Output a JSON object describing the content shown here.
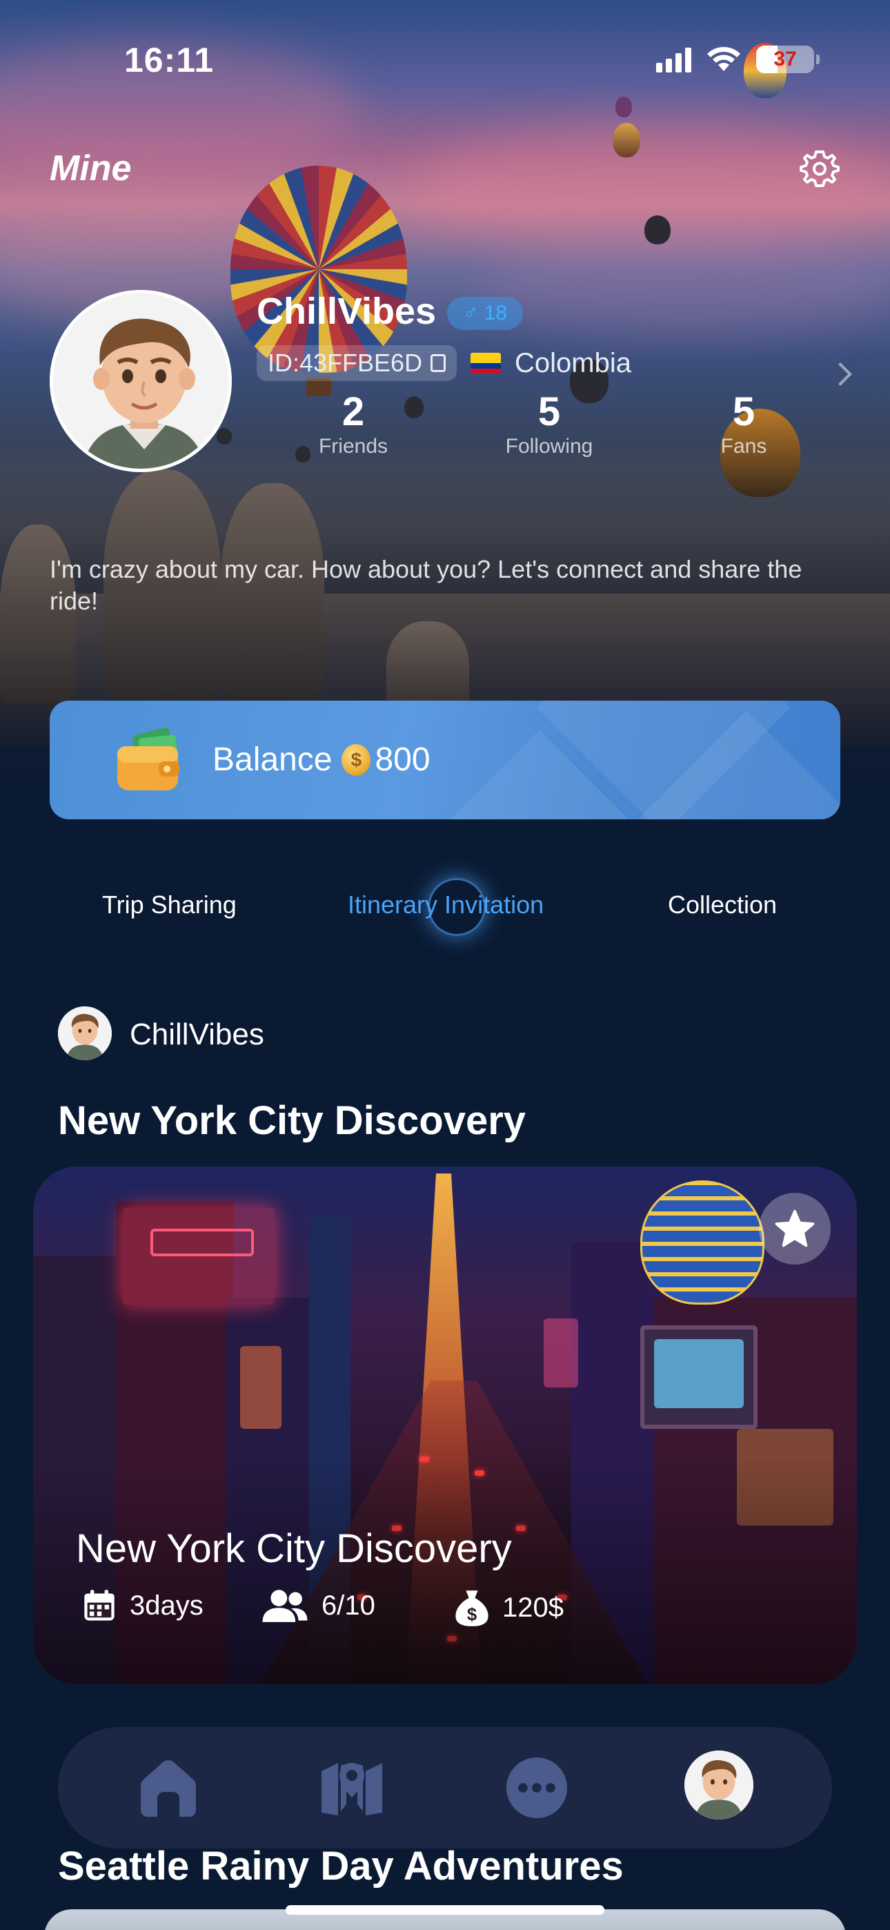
{
  "status_bar": {
    "time": "16:11",
    "battery": "37"
  },
  "header": {
    "title": "Mine"
  },
  "profile": {
    "username": "ChillVibes",
    "level": "18",
    "id": "ID:43FFBE6D",
    "country": "Colombia",
    "stats": [
      {
        "value": "2",
        "label": "Friends"
      },
      {
        "value": "5",
        "label": "Following"
      },
      {
        "value": "5",
        "label": "Fans"
      }
    ],
    "bio": "I'm crazy about my car. How about you? Let's connect and share the ride!"
  },
  "balance": {
    "label": "Balance",
    "amount": "800"
  },
  "tabs": [
    {
      "label": "Trip Sharing",
      "active": false
    },
    {
      "label": "Itinerary Invitation",
      "active": true
    },
    {
      "label": "Collection",
      "active": false
    }
  ],
  "posts": [
    {
      "author": "ChillVibes",
      "title": "New York City Discovery",
      "card_title": "New York City Discovery",
      "duration": "3days",
      "participants": "6/10",
      "budget": "120$"
    },
    {
      "title": "Seattle Rainy Day Adventures"
    }
  ],
  "colors": {
    "accent": "#4ba3f7",
    "background": "#0a1a33",
    "balance_card": "#4d90d7"
  },
  "icons": {
    "settings": "gear-icon",
    "copy": "copy-icon",
    "favorite": "star-icon",
    "calendar": "calendar-icon",
    "people": "people-icon",
    "money": "money-bag-icon",
    "nav": [
      "home-icon",
      "map-icon",
      "chat-icon",
      "profile-avatar"
    ]
  }
}
